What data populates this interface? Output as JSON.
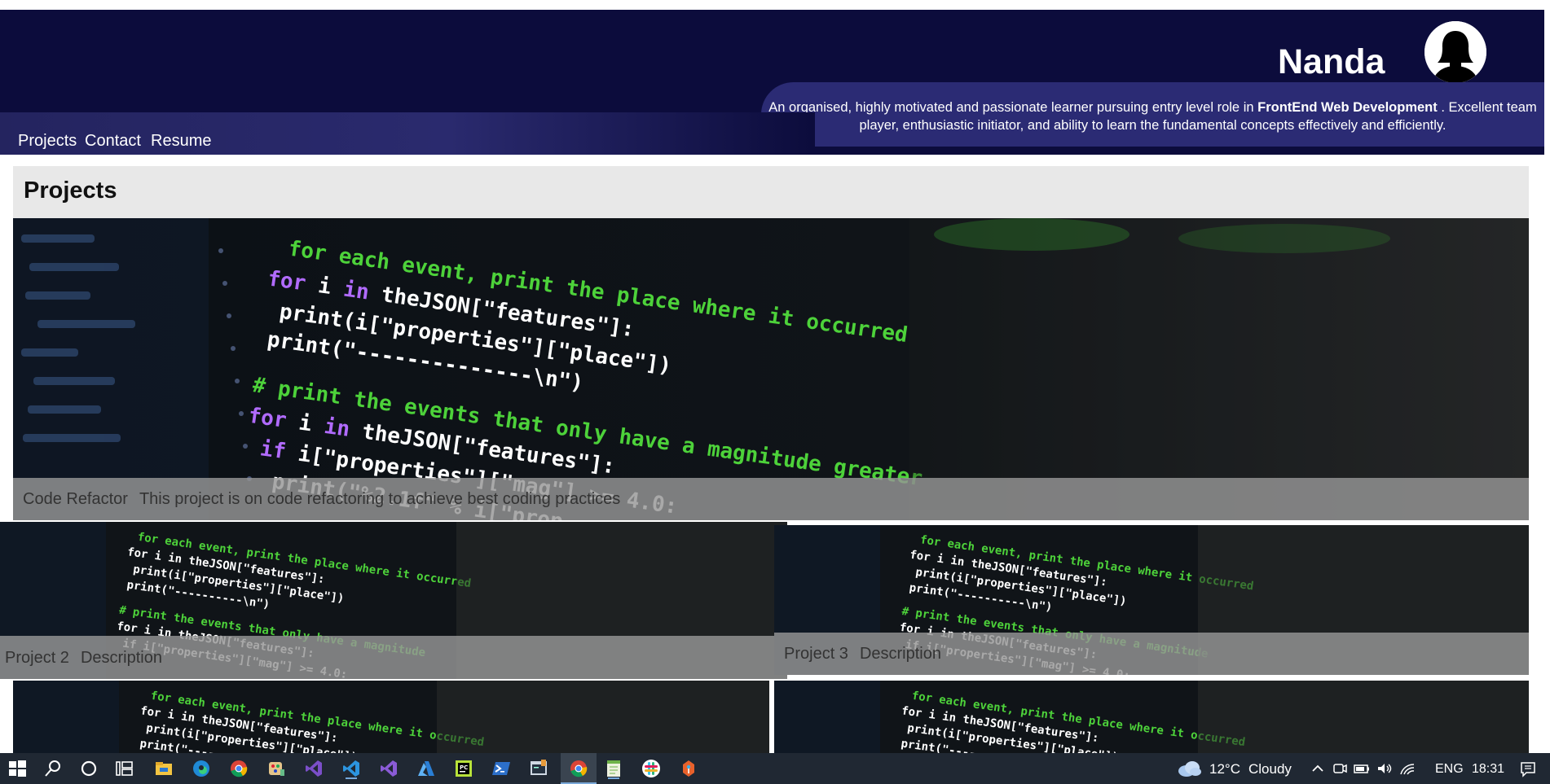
{
  "header": {
    "brand": "Nanda",
    "bio_intro": "An organised, highly motivated and passionate learner pursuing entry level role in ",
    "bio_highlight": "FrontEnd Web Development",
    "bio_outro": " . Excellent team player, enthusiastic initiator, and ability to learn the fundamental concepts effectively and efficiently.",
    "nav": [
      "Projects",
      "Contact",
      "Resume"
    ]
  },
  "projects": {
    "title": "Projects",
    "cards": [
      {
        "name": "Code Refactor",
        "description": "This project is on code refactoring to achieve best coding practices"
      },
      {
        "name": "Project 2",
        "description": "Description"
      },
      {
        "name": "Project 3",
        "description": "Description"
      },
      {
        "name": "",
        "description": ""
      },
      {
        "name": "",
        "description": ""
      }
    ]
  },
  "taskbar": {
    "weather_temp": "12°C",
    "weather_desc": "Cloudy",
    "language": "ENG",
    "time": "18:31",
    "apps": [
      "start-icon",
      "search-icon",
      "cortana-icon",
      "task-view-icon",
      "file-explorer-icon",
      "edge-icon",
      "chrome-icon",
      "paint-icon",
      "visual-studio-icon",
      "vscode-icon",
      "visual-studio-2-icon",
      "azure-icon",
      "pycharm-icon",
      "powershell-icon",
      "terminal-icon",
      "chrome-active-icon",
      "notepad-icon",
      "slack-icon",
      "git-icon"
    ]
  },
  "colors": {
    "header_bg": "#0c0c3c",
    "bio_bg": "#2b2b74",
    "code_green": "#4dd23a",
    "taskbar_bg": "#202833"
  }
}
